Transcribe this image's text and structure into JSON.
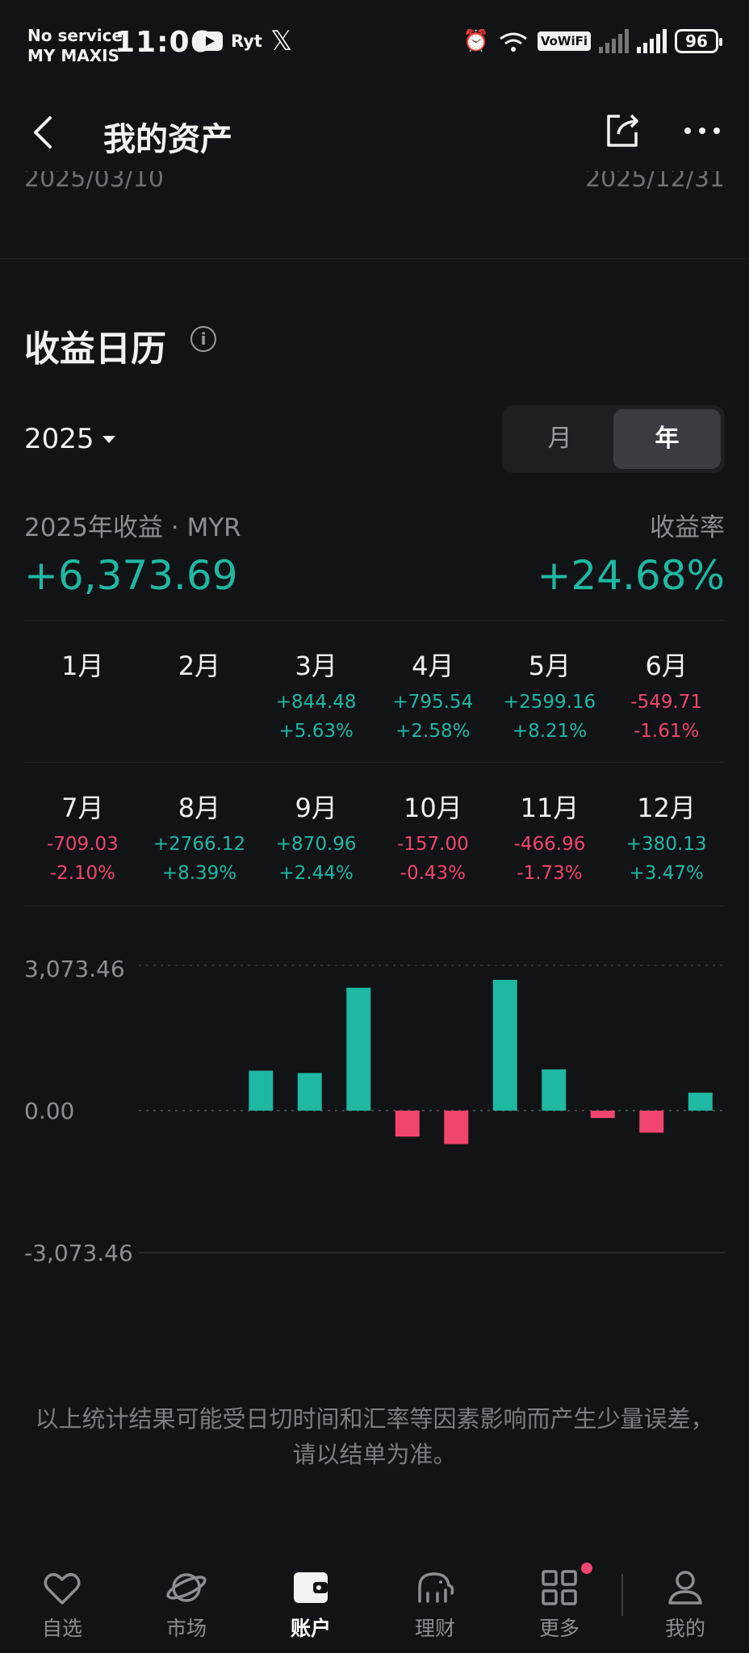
{
  "status_bar": {
    "carrier_line1": "No service",
    "carrier_line2": "MY MAXIS",
    "time": "11:06",
    "app_text": "Ryt",
    "vowifi": "VoWiFi",
    "battery": "96"
  },
  "header": {
    "title": "我的资产"
  },
  "cut_dates": {
    "left": "2025/03/10",
    "right": "2025/12/31"
  },
  "section": {
    "title": "收益日历"
  },
  "year_select": {
    "value": "2025"
  },
  "segmented": {
    "month": "月",
    "year": "年",
    "active": "年"
  },
  "summary": {
    "label": "2025年收益 · MYR",
    "value": "+6,373.69",
    "rate_label": "收益率",
    "rate_value": "+24.68%"
  },
  "months": [
    {
      "name": "1月",
      "amount": "",
      "pct": "",
      "sign": ""
    },
    {
      "name": "2月",
      "amount": "",
      "pct": "",
      "sign": ""
    },
    {
      "name": "3月",
      "amount": "+844.48",
      "pct": "+5.63%",
      "sign": "pos"
    },
    {
      "name": "4月",
      "amount": "+795.54",
      "pct": "+2.58%",
      "sign": "pos"
    },
    {
      "name": "5月",
      "amount": "+2599.16",
      "pct": "+8.21%",
      "sign": "pos"
    },
    {
      "name": "6月",
      "amount": "-549.71",
      "pct": "-1.61%",
      "sign": "neg"
    },
    {
      "name": "7月",
      "amount": "-709.03",
      "pct": "-2.10%",
      "sign": "neg"
    },
    {
      "name": "8月",
      "amount": "+2766.12",
      "pct": "+8.39%",
      "sign": "pos"
    },
    {
      "name": "9月",
      "amount": "+870.96",
      "pct": "+2.44%",
      "sign": "pos"
    },
    {
      "name": "10月",
      "amount": "-157.00",
      "pct": "-0.43%",
      "sign": "neg"
    },
    {
      "name": "11月",
      "amount": "-466.96",
      "pct": "-1.73%",
      "sign": "neg"
    },
    {
      "name": "12月",
      "amount": "+380.13",
      "pct": "+3.47%",
      "sign": "pos"
    }
  ],
  "chart_data": {
    "type": "bar",
    "categories": [
      "3月",
      "4月",
      "5月",
      "6月",
      "7月",
      "8月",
      "9月",
      "10月",
      "11月",
      "12月"
    ],
    "values": [
      844.48,
      795.54,
      2599.16,
      -549.71,
      -709.03,
      2766.12,
      870.96,
      -157.0,
      -466.96,
      380.13
    ],
    "y_tick_labels": [
      "3,073.46",
      "0.00",
      "-3,073.46"
    ],
    "ylim": [
      -3073.46,
      3073.46
    ],
    "positive_color": "#1fb8a2",
    "negative_color": "#f0456e"
  },
  "disclaimer": "以上统计结果可能受日切时间和汇率等因素影响而产生少量误差，请以结单为准。",
  "bottom_nav": [
    {
      "label": "自选",
      "icon": "heart-icon",
      "active": false
    },
    {
      "label": "市场",
      "icon": "planet-icon",
      "active": false
    },
    {
      "label": "账户",
      "icon": "wallet-icon",
      "active": true
    },
    {
      "label": "理财",
      "icon": "elephant-icon",
      "active": false
    },
    {
      "label": "更多",
      "icon": "grid-icon",
      "active": false
    },
    {
      "label": "我的",
      "icon": "person-icon",
      "active": false
    }
  ]
}
